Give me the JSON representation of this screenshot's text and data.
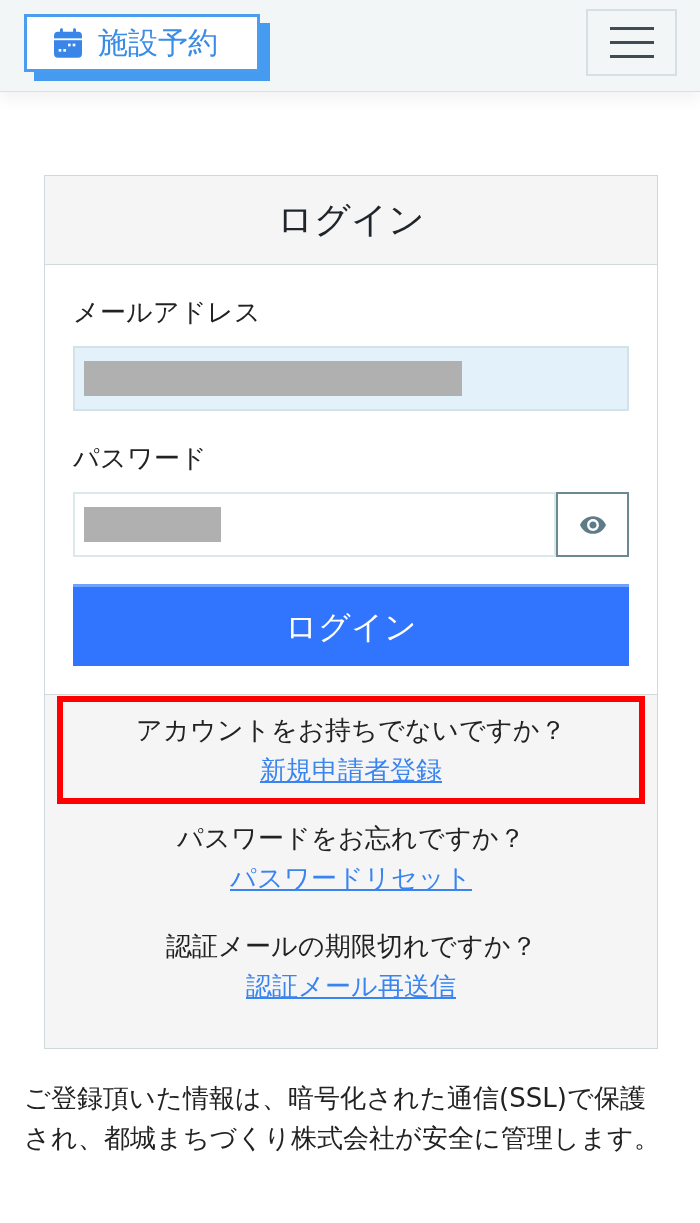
{
  "header": {
    "logo": {
      "text": "施設予約"
    }
  },
  "login_card": {
    "title": "ログイン",
    "fields": [
      {
        "label": "メールアドレス",
        "kind": "email",
        "autofilled": true,
        "redacted": true
      },
      {
        "label": "パスワード",
        "kind": "password",
        "autofilled": false,
        "redacted": true
      }
    ],
    "submit_button": "ログイン",
    "links": [
      {
        "question": "アカウントをお持ちでないですか？",
        "link": "新規申請者登録",
        "highlighted": true
      },
      {
        "question": "パスワードをお忘れですか？",
        "link": "パスワードリセット",
        "highlighted": false
      },
      {
        "question": "認証メールの期限切れですか？",
        "link": "認証メール再送信",
        "highlighted": false
      }
    ]
  },
  "notice": "ご登録頂いた情報は、暗号化された通信(SSL)で保護され、都城まちづくり株式会社が安全に管理します。"
}
